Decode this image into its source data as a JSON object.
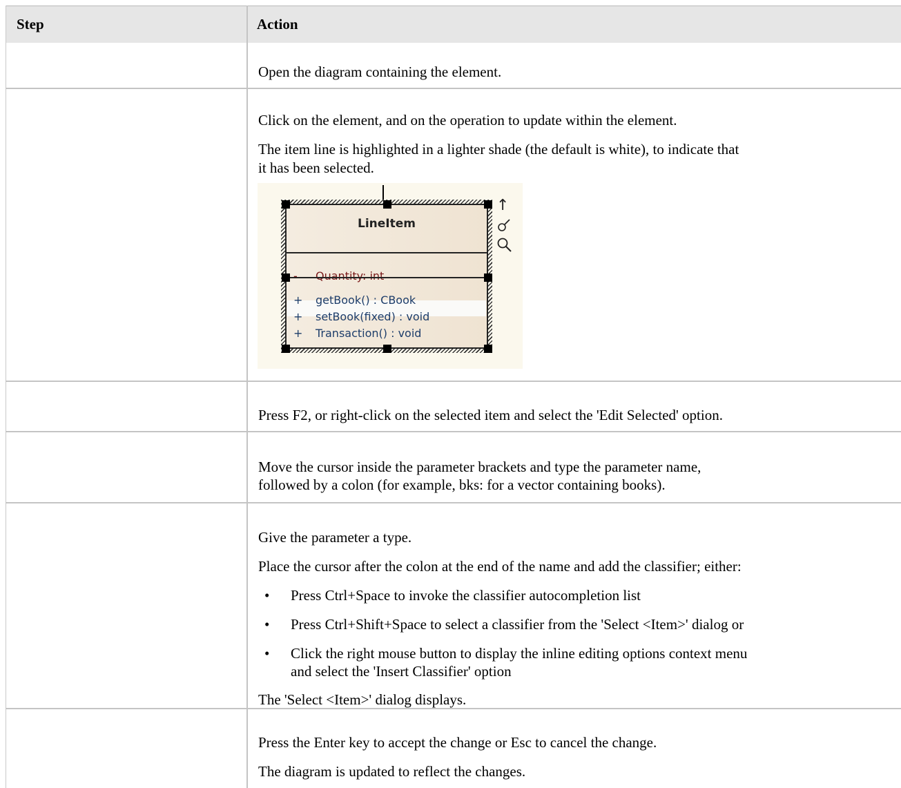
{
  "table": {
    "headers": {
      "step": "Step",
      "action": "Action"
    },
    "rows": [
      {
        "lines": [
          "Open the diagram containing the element."
        ]
      },
      {
        "lines": [
          "Click on the element, and on the operation to update within the element.",
          "The item line is highlighted in a lighter shade (the default is white), to indicate that",
          "it has been selected."
        ]
      },
      {
        "lines": [
          "Press F2, or right-click on the selected item and select the 'Edit Selected' option."
        ]
      },
      {
        "lines": [
          "Move the cursor inside the parameter brackets and type the parameter name,",
          "followed by a colon (for example, bks: for a vector containing books)."
        ]
      },
      {
        "lines": [
          "Give the parameter a type.",
          "Place the cursor after the colon at the end of the name and add the classifier; either:"
        ],
        "bullets": [
          "Press Ctrl+Space to invoke the classifier autocompletion list",
          "Press Ctrl+Shift+Space to select a classifier from the 'Select <Item>' dialog or",
          "Click the right mouse button to display the inline editing options context menu",
          "and select the 'Insert Classifier' option"
        ],
        "after": "The 'Select <Item>' dialog displays."
      },
      {
        "lines": [
          "Press the Enter key to accept the change or Esc to cancel the change.",
          "The diagram is updated to reflect the changes."
        ]
      }
    ]
  },
  "diagram": {
    "class_name": "LineItem",
    "attribute": {
      "visibility": "-",
      "text": "Quantity:  int"
    },
    "operations": [
      {
        "visibility": "+",
        "text": "getBook() : CBook",
        "selected": true
      },
      {
        "visibility": "+",
        "text": "setBook(fixed) : void"
      },
      {
        "visibility": "+",
        "text": "Transaction() : void"
      }
    ],
    "side_icons": {
      "arrow": "↑",
      "brush": "♂",
      "zoom": "🔍"
    },
    "icon_names": [
      "up-arrow-icon",
      "paintbrush-icon",
      "magnifier-icon"
    ]
  }
}
